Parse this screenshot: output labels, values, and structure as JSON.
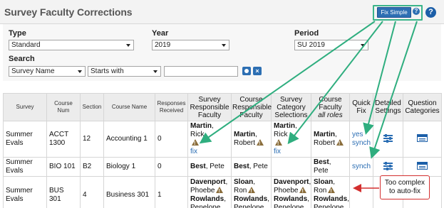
{
  "header": {
    "title": "Survey Faculty Corrections",
    "fix_simple_label": "Fix Simple",
    "fix_help_glyph": "?",
    "help_glyph": "?"
  },
  "filters": {
    "type_label": "Type",
    "type_value": "Standard",
    "year_label": "Year",
    "year_value": "2019",
    "period_label": "Period",
    "period_value": "SU 2019",
    "search_label": "Search",
    "search_field_value": "Survey Name",
    "search_op_value": "Starts with",
    "search_text_value": "",
    "clear_glyph": "×"
  },
  "table": {
    "headers": {
      "survey": "Survey",
      "course_num": "Course Num",
      "section": "Section",
      "course_name": "Course Name",
      "responses": "Responses Received",
      "srf": "Survey Responsible Faculty",
      "crf": "Course Responsible Faculty",
      "scs": "Survey Category Selections",
      "cf_title": "Course Faculty",
      "cf_sub": "all roles",
      "quick_fix": "Quick Fix",
      "detailed": "Detailed Settings",
      "question_categories": "Question Categories"
    },
    "rows": [
      {
        "survey": "Summer Evals",
        "course_num": "ACCT 1300",
        "section": "12",
        "course_name": "Accounting 1",
        "responses": "0",
        "srf_last": "Martin",
        "srf_first": ", Rick",
        "srf_fix": "fix",
        "crf_last": "Martin",
        "crf_first": ", Robert",
        "scs_last": "Martin",
        "scs_first": ", Rick",
        "scs_fix": "fix",
        "cf_last": "Martin",
        "cf_first": ", Robert",
        "quick_fix_1": "yes",
        "quick_fix_2": "synch"
      },
      {
        "survey": "Summer Evals",
        "course_num": "BIO 101",
        "section": "B2",
        "course_name": "Biology 1",
        "responses": "0",
        "srf_last": "Best",
        "srf_first": ", Pete",
        "crf_last": "Best",
        "crf_first": ", Pete",
        "cf_last": "Best",
        "cf_first": ", Pete",
        "quick_fix_1": "synch"
      },
      {
        "survey": "Summer Evals",
        "course_num": "BUS 301",
        "section": "4",
        "course_name": "Business 301",
        "responses": "1",
        "srf_a_last": "Davenport",
        "srf_a_first": ", Phoebe",
        "srf_b_last": "Rowlands",
        "srf_b_first": ", Penelope",
        "crf_a_last": "Sloan",
        "crf_a_first": ", Ron",
        "crf_b_last": "Rowlands",
        "crf_b_first": ", Penelope",
        "scs_a_last": "Davenport",
        "scs_a_first": ", Phoebe",
        "scs_b_last": "Rowlands",
        "scs_b_first": ", Penelope",
        "cf_a_last": "Sloan",
        "cf_a_first": ", Ron",
        "cf_b_last": "Rowlands",
        "cf_b_first": ", Penelope"
      }
    ]
  },
  "annotation": {
    "callout_line1": "Too complex",
    "callout_line2": "to auto-fix",
    "arrow_color": "#2fae7f",
    "callout_color": "#d32f2f"
  }
}
